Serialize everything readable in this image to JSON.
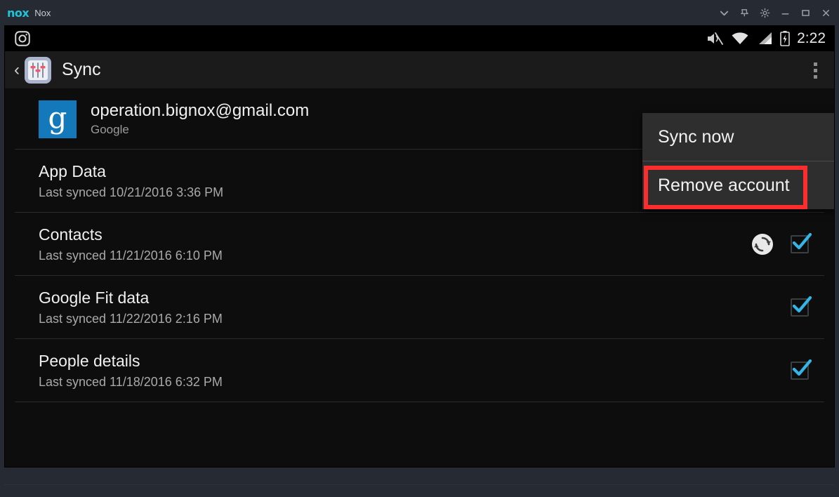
{
  "window": {
    "logo_text": "nox",
    "app_name": "Nox",
    "controls": [
      {
        "name": "chevron-down-icon",
        "label": "Collapse"
      },
      {
        "name": "pin-icon",
        "label": "Pin"
      },
      {
        "name": "gear-icon",
        "label": "Settings"
      },
      {
        "name": "minimize-icon",
        "label": "Minimize"
      },
      {
        "name": "maximize-icon",
        "label": "Maximize"
      },
      {
        "name": "close-icon",
        "label": "Close"
      }
    ]
  },
  "statusbar": {
    "left_icons": [
      "instagram-camera-icon"
    ],
    "right_icons": [
      "mute-icon",
      "wifi-icon",
      "signal-icon",
      "battery-charging-icon"
    ],
    "time": "2:22"
  },
  "actionbar": {
    "back_glyph": "‹",
    "app_icon_name": "settings-sliders-icon",
    "title": "Sync",
    "overflow_name": "overflow-menu-icon"
  },
  "account": {
    "avatar_letter": "g",
    "email": "operation.bignox@gmail.com",
    "provider": "Google"
  },
  "sync_items": [
    {
      "title": "App Data",
      "last_synced": "Last synced 10/21/2016 3:36 PM",
      "syncing": false,
      "checked": true
    },
    {
      "title": "Contacts",
      "last_synced": "Last synced 11/21/2016 6:10 PM",
      "syncing": true,
      "checked": true
    },
    {
      "title": "Google Fit data",
      "last_synced": "Last synced 11/22/2016 2:16 PM",
      "syncing": false,
      "checked": true
    },
    {
      "title": "People details",
      "last_synced": "Last synced 11/18/2016 6:32 PM",
      "syncing": false,
      "checked": true
    }
  ],
  "overflow_menu": {
    "items": [
      {
        "label": "Sync now",
        "highlighted": false
      },
      {
        "label": "Remove account",
        "highlighted": true
      }
    ]
  },
  "annotation": {
    "target": "Remove account",
    "color": "#fc2d2d"
  },
  "colors": {
    "nox_frame": "#262a33",
    "nox_logo": "#21c3d6",
    "android_bg": "#0d0d0d",
    "actionbar": "#1b1b1b",
    "checkbox_accent": "#33b5e5",
    "google_blue": "#1479bb",
    "menu_bg": "#2e2e2e",
    "highlight": "#fc2d2d"
  }
}
